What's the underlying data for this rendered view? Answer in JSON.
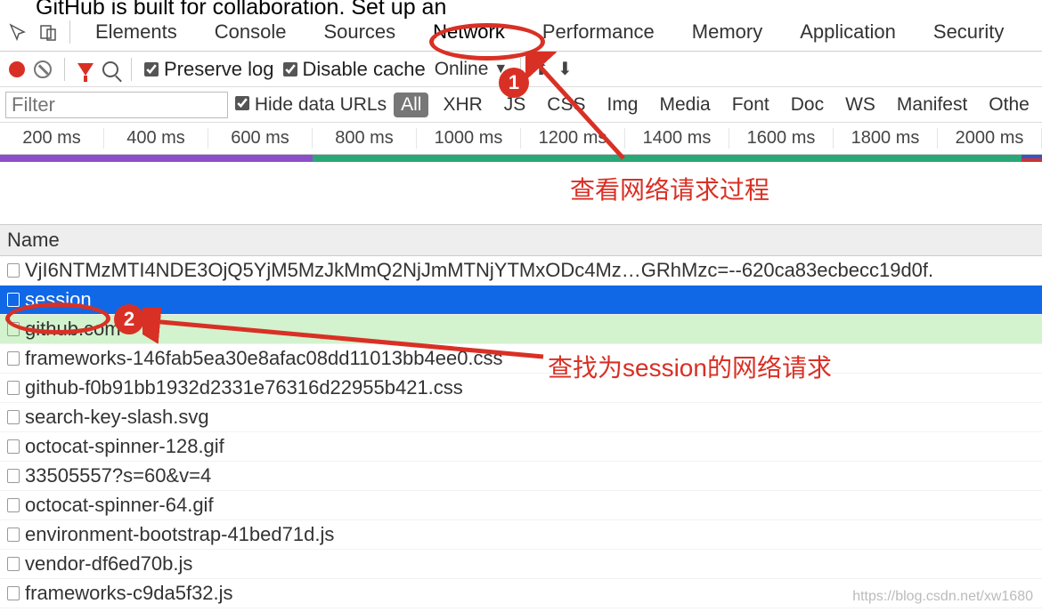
{
  "cut_text": "GitHub is built for collaboration. Set up an",
  "tabs": [
    "Elements",
    "Console",
    "Sources",
    "Network",
    "Performance",
    "Memory",
    "Application",
    "Security"
  ],
  "active_tab": "Network",
  "controls": {
    "preserve_log": "Preserve log",
    "disable_cache": "Disable cache",
    "throttle": "Online"
  },
  "filter": {
    "placeholder": "Filter",
    "hide_data_urls": "Hide data URLs",
    "types": [
      "All",
      "XHR",
      "JS",
      "CSS",
      "Img",
      "Media",
      "Font",
      "Doc",
      "WS",
      "Manifest",
      "Othe"
    ]
  },
  "timeline": [
    "200 ms",
    "400 ms",
    "600 ms",
    "800 ms",
    "1000 ms",
    "1200 ms",
    "1400 ms",
    "1600 ms",
    "1800 ms",
    "2000 ms"
  ],
  "name_header": "Name",
  "requests": [
    "VjI6NTMzMTI4NDE3OjQ5YjM5MzJkMmQ2NjJmMTNjYTMxODc4Mz…GRhMzc=--620ca83ecbecc19d0f.",
    "session",
    "github.com",
    "frameworks-146fab5ea30e8afac08dd11013bb4ee0.css",
    "github-f0b91bb1932d2331e76316d22955b421.css",
    "search-key-slash.svg",
    "octocat-spinner-128.gif",
    "33505557?s=60&v=4",
    "octocat-spinner-64.gif",
    "environment-bootstrap-41bed71d.js",
    "vendor-df6ed70b.js",
    "frameworks-c9da5f32.js"
  ],
  "annotations": {
    "num1": "1",
    "num2": "2",
    "text1": "查看网络请求过程",
    "text2": "查找为session的网络请求"
  },
  "watermark": "https://blog.csdn.net/xw1680"
}
